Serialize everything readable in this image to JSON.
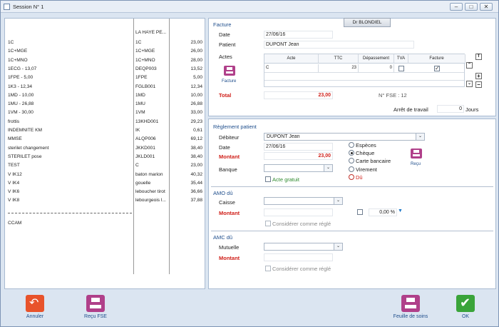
{
  "window": {
    "title": "Session N° 1"
  },
  "left_list": {
    "header_col2": "LA HAYE PE...",
    "rows": [
      {
        "label": "1C",
        "code": "1C",
        "amount": "23,00"
      },
      {
        "label": "1C+MGE",
        "code": "1C+MGE",
        "amount": "26,00"
      },
      {
        "label": "1C+MNO",
        "code": "1C+MNO",
        "amount": "28,00"
      },
      {
        "label": "1ECG - 13,07",
        "code": "DEQP003",
        "amount": "13,52"
      },
      {
        "label": "1FPE - 5,00",
        "code": "1FPE",
        "amount": "5,00"
      },
      {
        "label": "1K3 - 12,34",
        "code": "FGLB001",
        "amount": "12,34"
      },
      {
        "label": "1MD - 10,00",
        "code": "1MD",
        "amount": "10,00"
      },
      {
        "label": "1MU - 26,88",
        "code": "1MU",
        "amount": "26,88"
      },
      {
        "label": "1VM - 30,00",
        "code": "1VM",
        "amount": "33,00"
      },
      {
        "label": "frottis",
        "code": "13KHD001",
        "amount": "29,23"
      },
      {
        "label": "INDEMNITE KM",
        "code": "IK",
        "amount": "0,61"
      },
      {
        "label": "MMSE",
        "code": "ALQP006",
        "amount": "69,12"
      },
      {
        "label": "sterilet changement",
        "code": "JKKD001",
        "amount": "38,40"
      },
      {
        "label": "STERILET pose",
        "code": "JKLD001",
        "amount": "38,40"
      },
      {
        "label": "TEST",
        "code": "C",
        "amount": "23,00"
      },
      {
        "label": "V IK12",
        "code": "baton marion",
        "amount": "40,32"
      },
      {
        "label": "V IK4",
        "code": "gouelle",
        "amount": "35,44"
      },
      {
        "label": "V IK6",
        "code": "leboucher tirot",
        "amount": "36,66"
      },
      {
        "label": "V IK8",
        "code": "lebourgeois l...",
        "amount": "37,88"
      }
    ],
    "footer_label": "CCAM"
  },
  "facture": {
    "section_title": "Facture",
    "doctor_button": "Dr BLONDIEL",
    "date_label": "Date",
    "date_value": "27/06/16",
    "patient_label": "Patient",
    "patient_value": "DUPONT Jean",
    "actes_label": "Actes",
    "print_label": "Facture",
    "table_headers": [
      "Acte",
      "TTC",
      "Dépassement",
      "TVA",
      "Facture"
    ],
    "row": {
      "acte": "C",
      "ttc": "23",
      "depassement": "0",
      "tva_checked": false,
      "facture_checked": true
    },
    "total_label": "Total",
    "total_value": "23,00",
    "fse_label": "N° FSE : 12",
    "arret_label": "Arrêt de travail",
    "arret_value": "0",
    "arret_unit": "Jours"
  },
  "reglement": {
    "section_title": "Règlement patient",
    "debiteur_label": "Débiteur",
    "debiteur_value": "DUPONT Jean",
    "date_label": "Date",
    "date_value": "27/06/16",
    "montant_label": "Montant",
    "montant_value": "23,00",
    "banque_label": "Banque",
    "banque_value": "",
    "acte_gratuit_label": "Acte gratuit",
    "payment_options": [
      "Espèces",
      "Chèque",
      "Carte bancaire",
      "Virement",
      "Dû"
    ],
    "selected_payment": "Chèque",
    "recu_label": "Reçu"
  },
  "amo": {
    "section_title": "AMO dû",
    "caisse_label": "Caisse",
    "caisse_value": "",
    "montant_label": "Montant",
    "montant_value": "",
    "percent_value": "0,00 %",
    "considerer_label": "Considérer comme réglé"
  },
  "amc": {
    "section_title": "AMC dû",
    "mutuelle_label": "Mutuelle",
    "mutuelle_value": "",
    "montant_label": "Montant",
    "montant_value": "",
    "considerer_label": "Considérer comme réglé"
  },
  "footer_buttons": {
    "annuler": "Annuler",
    "recu_fse": "Reçu FSE",
    "feuille": "Feuille de soins",
    "ok": "OK"
  },
  "colors": {
    "accent": "#1f4e8c",
    "red": "#d0201a",
    "background": "#dbe5f1"
  }
}
